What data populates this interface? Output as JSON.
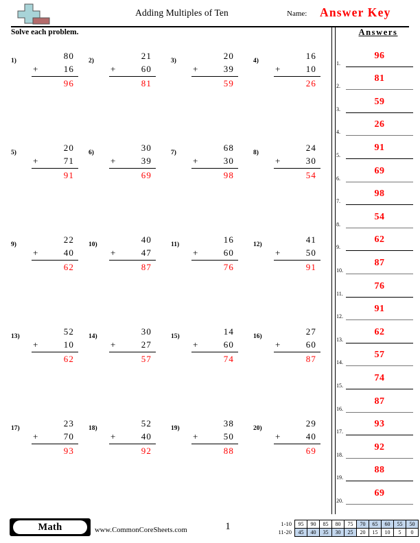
{
  "header": {
    "logo_icon": "plus-minus-logo-icon",
    "title": "Adding Multiples of Ten",
    "name_label": "Name:",
    "answer_key_label": "Answer Key",
    "instruction": "Solve each problem."
  },
  "answers_panel": {
    "heading": "Answers",
    "items": [
      {
        "index": "1.",
        "value": "96"
      },
      {
        "index": "2.",
        "value": "81"
      },
      {
        "index": "3.",
        "value": "59"
      },
      {
        "index": "4.",
        "value": "26"
      },
      {
        "index": "5.",
        "value": "91"
      },
      {
        "index": "6.",
        "value": "69"
      },
      {
        "index": "7.",
        "value": "98"
      },
      {
        "index": "8.",
        "value": "54"
      },
      {
        "index": "9.",
        "value": "62"
      },
      {
        "index": "10.",
        "value": "87"
      },
      {
        "index": "11.",
        "value": "76"
      },
      {
        "index": "12.",
        "value": "91"
      },
      {
        "index": "13.",
        "value": "62"
      },
      {
        "index": "14.",
        "value": "57"
      },
      {
        "index": "15.",
        "value": "74"
      },
      {
        "index": "16.",
        "value": "87"
      },
      {
        "index": "17.",
        "value": "93"
      },
      {
        "index": "18.",
        "value": "92"
      },
      {
        "index": "19.",
        "value": "88"
      },
      {
        "index": "20.",
        "value": "69"
      }
    ]
  },
  "problems": [
    {
      "num": "1)",
      "top": "80",
      "op": "+",
      "bottom": "16",
      "sum": "96"
    },
    {
      "num": "2)",
      "top": "21",
      "op": "+",
      "bottom": "60",
      "sum": "81"
    },
    {
      "num": "3)",
      "top": "20",
      "op": "+",
      "bottom": "39",
      "sum": "59"
    },
    {
      "num": "4)",
      "top": "16",
      "op": "+",
      "bottom": "10",
      "sum": "26"
    },
    {
      "num": "5)",
      "top": "20",
      "op": "+",
      "bottom": "71",
      "sum": "91"
    },
    {
      "num": "6)",
      "top": "30",
      "op": "+",
      "bottom": "39",
      "sum": "69"
    },
    {
      "num": "7)",
      "top": "68",
      "op": "+",
      "bottom": "30",
      "sum": "98"
    },
    {
      "num": "8)",
      "top": "24",
      "op": "+",
      "bottom": "30",
      "sum": "54"
    },
    {
      "num": "9)",
      "top": "22",
      "op": "+",
      "bottom": "40",
      "sum": "62"
    },
    {
      "num": "10)",
      "top": "40",
      "op": "+",
      "bottom": "47",
      "sum": "87"
    },
    {
      "num": "11)",
      "top": "16",
      "op": "+",
      "bottom": "60",
      "sum": "76"
    },
    {
      "num": "12)",
      "top": "41",
      "op": "+",
      "bottom": "50",
      "sum": "91"
    },
    {
      "num": "13)",
      "top": "52",
      "op": "+",
      "bottom": "10",
      "sum": "62"
    },
    {
      "num": "14)",
      "top": "30",
      "op": "+",
      "bottom": "27",
      "sum": "57"
    },
    {
      "num": "15)",
      "top": "14",
      "op": "+",
      "bottom": "60",
      "sum": "74"
    },
    {
      "num": "16)",
      "top": "27",
      "op": "+",
      "bottom": "60",
      "sum": "87"
    },
    {
      "num": "17)",
      "top": "23",
      "op": "+",
      "bottom": "70",
      "sum": "93"
    },
    {
      "num": "18)",
      "top": "52",
      "op": "+",
      "bottom": "40",
      "sum": "92"
    },
    {
      "num": "19)",
      "top": "38",
      "op": "+",
      "bottom": "50",
      "sum": "88"
    },
    {
      "num": "20)",
      "top": "29",
      "op": "+",
      "bottom": "40",
      "sum": "69"
    }
  ],
  "footer": {
    "subject_badge": "Math",
    "site_url": "www.CommonCoreSheets.com",
    "page_number": "1",
    "score_table": {
      "row1_label": "1-10",
      "row2_label": "11-20",
      "row1": [
        {
          "v": "95",
          "hl": false
        },
        {
          "v": "90",
          "hl": false
        },
        {
          "v": "85",
          "hl": false
        },
        {
          "v": "80",
          "hl": false
        },
        {
          "v": "75",
          "hl": false
        },
        {
          "v": "70",
          "hl": true
        },
        {
          "v": "65",
          "hl": true
        },
        {
          "v": "60",
          "hl": true
        },
        {
          "v": "55",
          "hl": true
        },
        {
          "v": "50",
          "hl": true
        }
      ],
      "row2": [
        {
          "v": "45",
          "hl": true
        },
        {
          "v": "40",
          "hl": true
        },
        {
          "v": "35",
          "hl": true
        },
        {
          "v": "30",
          "hl": true
        },
        {
          "v": "25",
          "hl": true
        },
        {
          "v": "20",
          "hl": false
        },
        {
          "v": "15",
          "hl": false
        },
        {
          "v": "10",
          "hl": false
        },
        {
          "v": "5",
          "hl": false
        },
        {
          "v": "0",
          "hl": false
        }
      ]
    }
  },
  "colors": {
    "answer_red": "#ff0000",
    "logo_plus": "#a8d4d8",
    "logo_minus": "#b46a6a",
    "highlight": "#c3d7ee"
  }
}
